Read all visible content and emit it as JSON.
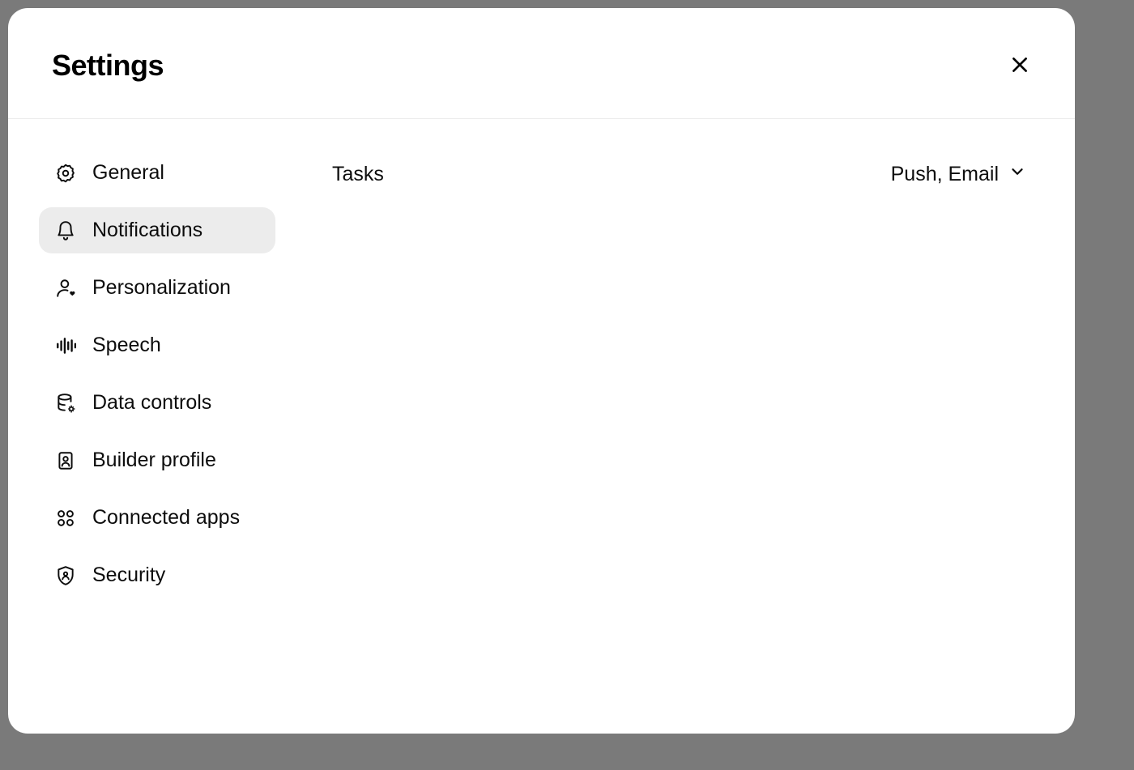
{
  "modal": {
    "title": "Settings"
  },
  "sidebar": {
    "items": [
      {
        "label": "General",
        "icon": "gear-icon",
        "active": false
      },
      {
        "label": "Notifications",
        "icon": "bell-icon",
        "active": true
      },
      {
        "label": "Personalization",
        "icon": "person-heart-icon",
        "active": false
      },
      {
        "label": "Speech",
        "icon": "waveform-icon",
        "active": false
      },
      {
        "label": "Data controls",
        "icon": "database-gear-icon",
        "active": false
      },
      {
        "label": "Builder profile",
        "icon": "id-card-icon",
        "active": false
      },
      {
        "label": "Connected apps",
        "icon": "apps-grid-icon",
        "active": false
      },
      {
        "label": "Security",
        "icon": "shield-person-icon",
        "active": false
      }
    ]
  },
  "content": {
    "settings": [
      {
        "label": "Tasks",
        "value": "Push, Email"
      }
    ]
  }
}
